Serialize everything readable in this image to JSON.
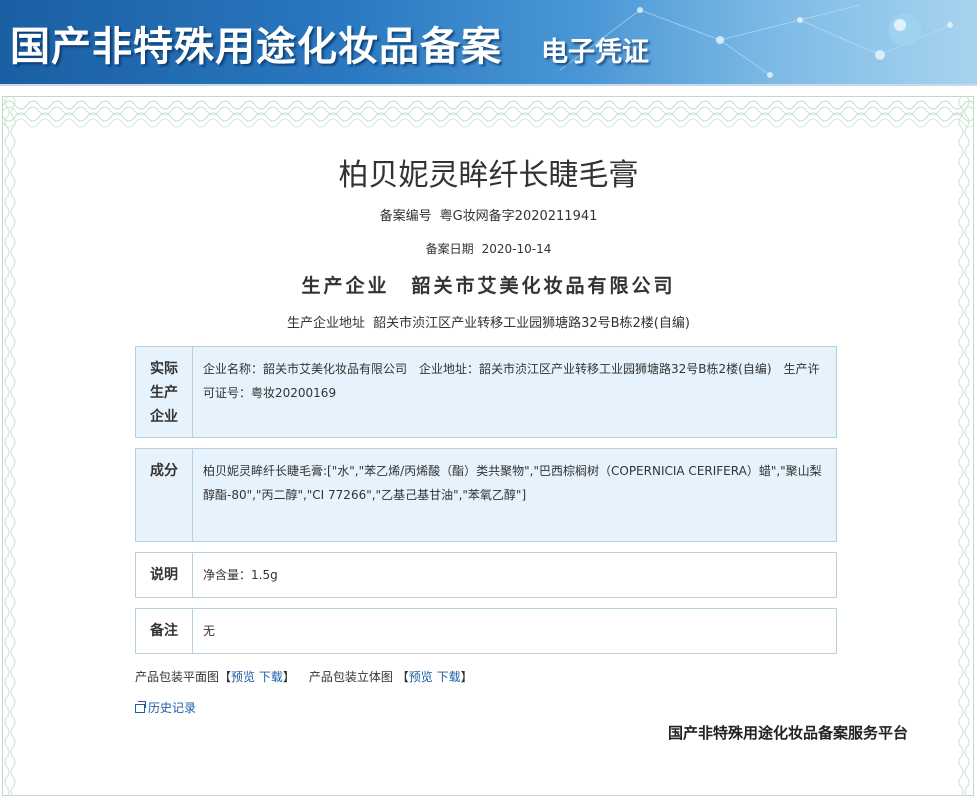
{
  "banner": {
    "title": "国产非特殊用途化妆品备案",
    "subtitle": "电子凭证"
  },
  "product": {
    "name": "柏贝妮灵眸纤长睫毛膏",
    "record_no_label": "备案编号",
    "record_no": "粤G妆网备字2020211941",
    "record_date_label": "备案日期",
    "record_date": "2020-10-14",
    "producer_label": "生产企业",
    "producer": "韶关市艾美化妆品有限公司",
    "producer_addr_label": "生产企业地址",
    "producer_addr": "韶关市浈江区产业转移工业园狮塘路32号B栋2楼(自编)"
  },
  "sections": {
    "actual_producer": {
      "label_lines": [
        "实际",
        "生产",
        "企业"
      ],
      "content": "企业名称：韶关市艾美化妆品有限公司　企业地址：韶关市浈江区产业转移工业园狮塘路32号B栋2楼(自编)　生产许可证号：粤妆20200169"
    },
    "ingredients": {
      "label": "成分",
      "content": "柏贝妮灵眸纤长睫毛膏:[\"水\",\"苯乙烯/丙烯酸（酯）类共聚物\",\"巴西棕榈树（COPERNICIA CERIFERA）蜡\",\"聚山梨醇酯-80\",\"丙二醇\",\"CI 77266\",\"乙基己基甘油\",\"苯氧乙醇\"]"
    },
    "description": {
      "label": "说明",
      "content": "净含量：1.5g"
    },
    "remarks": {
      "label": "备注",
      "content": "无"
    }
  },
  "links": {
    "flat_label": "产品包装平面图【",
    "flat_preview": "预览",
    "flat_download": "下载",
    "flat_close": "】",
    "solid_label": "产品包装立体图 【",
    "solid_preview": "预览",
    "solid_download": "下载",
    "solid_close": "】",
    "history": "历史记录"
  },
  "footer": {
    "platform": "国产非特殊用途化妆品备案服务平台"
  },
  "colors": {
    "banner_blue": "#1a5fa3",
    "box_blue": "#e6f3fc",
    "link_blue": "#1a5fa8"
  }
}
